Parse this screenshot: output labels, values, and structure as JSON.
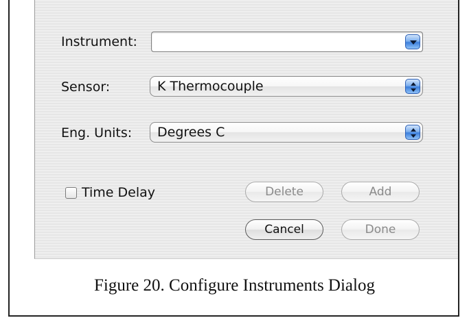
{
  "form": {
    "instrument": {
      "label": "Instrument:",
      "value": ""
    },
    "sensor": {
      "label": "Sensor:",
      "value": "K Thermocouple"
    },
    "eng_units": {
      "label": "Eng. Units:",
      "value": "Degrees C"
    },
    "time_delay": {
      "label": "Time Delay",
      "checked": false
    }
  },
  "buttons": {
    "delete": "Delete",
    "add": "Add",
    "cancel": "Cancel",
    "done": "Done"
  },
  "caption": "Figure 20.  Configure Instruments Dialog",
  "colors": {
    "accent": "#3c7fdc",
    "disabled_text": "#8a8a8a"
  },
  "icons": {
    "combo_arrow": "chevron-down-icon",
    "popup_arrows": "up-down-arrows-icon"
  }
}
